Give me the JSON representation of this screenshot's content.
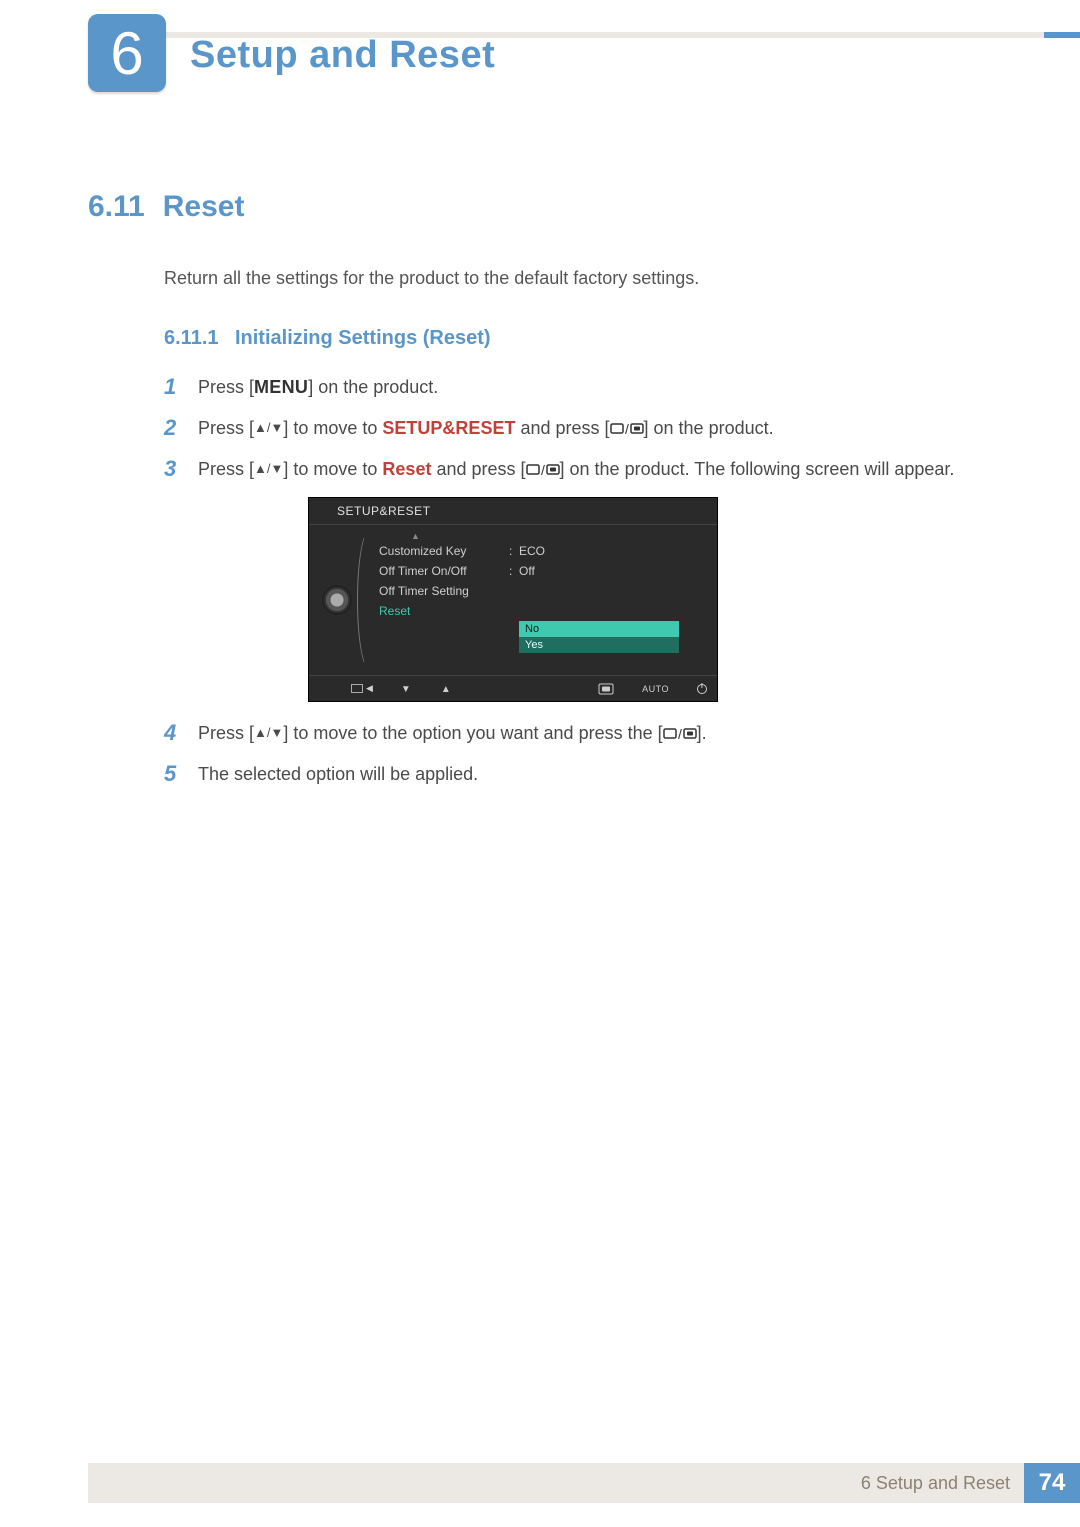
{
  "header": {
    "chapter_number": "6",
    "chapter_title": "Setup and Reset"
  },
  "section": {
    "number": "6.11",
    "title": "Reset"
  },
  "intro": "Return all the settings for the product to the default factory settings.",
  "subsection": {
    "number": "6.11.1",
    "title": "Initializing Settings (Reset)"
  },
  "steps": [
    {
      "n": "1",
      "prefix": "Press [",
      "menu": "MENU",
      "suffix": "] on the product."
    },
    {
      "n": "2",
      "prefix": "Press [",
      "after_arrows": "] to move to ",
      "target": "SETUP&RESET",
      "after_target": " and press [",
      "tail": "] on the product."
    },
    {
      "n": "3",
      "prefix": "Press [",
      "after_arrows": "] to move to ",
      "target": "Reset",
      "after_target": " and press [",
      "tail": "] on the product. The following screen will appear."
    },
    {
      "n": "4",
      "prefix": "Press [",
      "after_arrows": "] to move to the option you want and press the [",
      "tail": "]."
    },
    {
      "n": "5",
      "text": "The selected option will be applied."
    }
  ],
  "osd": {
    "title": "SETUP&RESET",
    "rows": [
      {
        "label": "Customized Key",
        "value": "ECO"
      },
      {
        "label": "Off Timer On/Off",
        "value": "Off"
      },
      {
        "label": "Off Timer Setting",
        "value": ""
      },
      {
        "label": "Reset",
        "value": "",
        "selected": true
      }
    ],
    "options": {
      "highlight": "No",
      "other": "Yes"
    },
    "footer_auto": "AUTO"
  },
  "footer": {
    "text": "6 Setup and Reset",
    "page": "74"
  }
}
